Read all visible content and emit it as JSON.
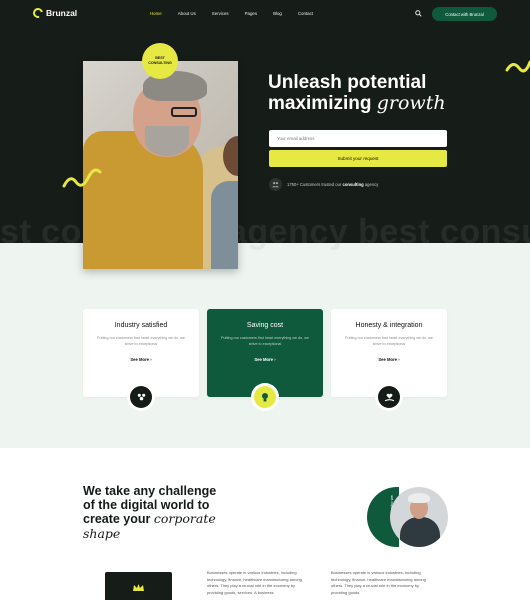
{
  "brand": {
    "name": "Brunzal"
  },
  "nav": {
    "items": [
      {
        "label": "Home",
        "active": true
      },
      {
        "label": "About Us"
      },
      {
        "label": "Services"
      },
      {
        "label": "Pages"
      },
      {
        "label": "Blog"
      },
      {
        "label": "Contact"
      }
    ],
    "contact_button": "Contact with Brunzal"
  },
  "hero": {
    "badge_line1": "BEST",
    "badge_line2": "CONSULTING",
    "title_line1": "Unleash potential",
    "title_line2_plain": "maximizing ",
    "title_line2_em": "growth",
    "email_placeholder": "Your email address",
    "submit_label": "Submit your request",
    "trust_prefix": "1750+ Customers trusted our ",
    "trust_bold": "consulting",
    "trust_suffix": " agency",
    "watermark": "st consulting agency   best consulting agency"
  },
  "cards": [
    {
      "title": "Industry satisfied",
      "text": "Putting our customers first heart everything we do, we strive to exceptional",
      "more": "See More"
    },
    {
      "title": "Saving cost",
      "text": "Putting our customers first heart everything we do, we strive to exceptional",
      "more": "See More"
    },
    {
      "title": "Honesty & integration",
      "text": "Putting our customers first heart everything we do, we strive to exceptional",
      "more": "See More"
    }
  ],
  "challenge": {
    "line1": "We take any challenge",
    "line2": "of the digital world to",
    "line3_plain": "create your ",
    "line3_em": "corporate",
    "line4_em": "shape",
    "pill_label": "Know who we"
  },
  "paragraphs": [
    "Businesses operate in various industries, including technology, finance, healthcare manufacturing among others. They play a crucial role in the economy by providing goods, services. A business",
    "Businesses operate in various industries, including technology, finance, healthcare manufacturing among others. They play a crucial role in the economy by providing goods"
  ],
  "colors": {
    "accent": "#e6e843",
    "brand_green": "#0f5a3c",
    "dark": "#161c18"
  }
}
